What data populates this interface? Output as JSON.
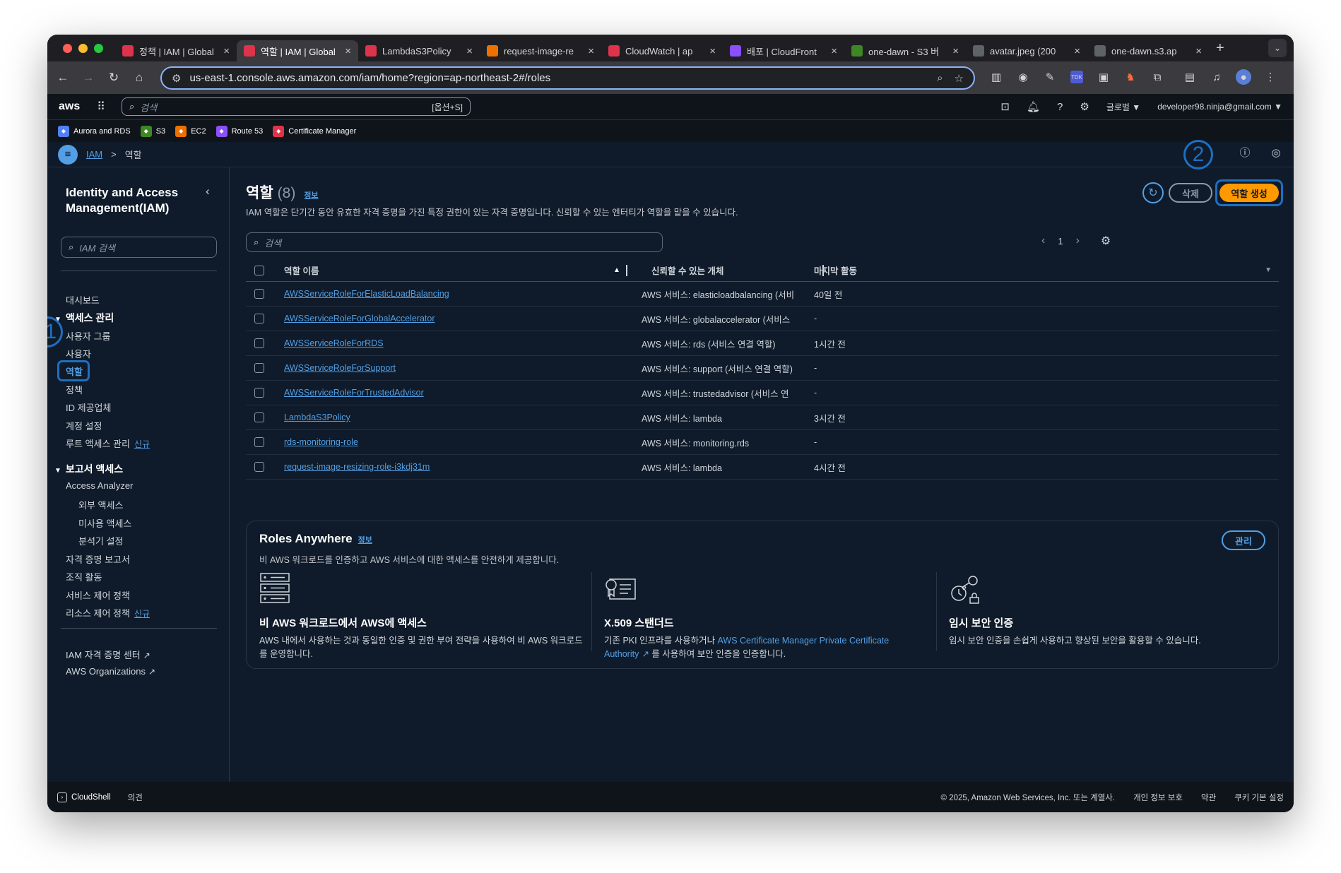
{
  "browser": {
    "tabs": [
      {
        "title": "정책 | IAM | Global",
        "active": false,
        "color": "#dd344c"
      },
      {
        "title": "역할 | IAM | Global",
        "active": true,
        "color": "#dd344c"
      },
      {
        "title": "LambdaS3Policy",
        "active": false,
        "color": "#dd344c"
      },
      {
        "title": "request-image-re",
        "active": false,
        "color": "#ed7100"
      },
      {
        "title": "CloudWatch | ap",
        "active": false,
        "color": "#dd344c"
      },
      {
        "title": "배포 | CloudFront",
        "active": false,
        "color": "#8c4fff"
      },
      {
        "title": "one-dawn - S3 버",
        "active": false,
        "color": "#3f8624"
      },
      {
        "title": "avatar.jpeg (200",
        "active": false,
        "color": "#5f6368"
      },
      {
        "title": "one-dawn.s3.ap",
        "active": false,
        "color": "#5f6368"
      }
    ],
    "url": "us-east-1.console.aws.amazon.com/iam/home?region=ap-northeast-2#/roles"
  },
  "aws_header": {
    "logo": "aws",
    "search_placeholder": "검색",
    "search_shortcut": "[옵션+S]",
    "region": "글로벌 ▼",
    "account": "developer98.ninja@gmail.com ▼"
  },
  "favorites": [
    {
      "label": "Aurora and RDS",
      "color": "#527fff"
    },
    {
      "label": "S3",
      "color": "#3f8624"
    },
    {
      "label": "EC2",
      "color": "#ed7100"
    },
    {
      "label": "Route 53",
      "color": "#8c4fff"
    },
    {
      "label": "Certificate Manager",
      "color": "#dd344c"
    }
  ],
  "breadcrumb": {
    "root": "IAM",
    "sep": ">",
    "current": "역할"
  },
  "annotations": {
    "one": "1",
    "two": "2"
  },
  "sidebar": {
    "title": "Identity and Access Management(IAM)",
    "search_placeholder": "IAM 검색",
    "dashboard": "대시보드",
    "access_mgmt": "액세스 관리",
    "items_access": [
      "사용자 그룹",
      "사용자",
      "역할",
      "정책",
      "ID 제공업체",
      "계정 설정",
      "루트 액세스 관리"
    ],
    "new_badge": "신규",
    "reports": "보고서 액세스",
    "access_analyzer": "Access Analyzer",
    "analyzer_sub": [
      "외부 액세스",
      "미사용 액세스",
      "분석기 설정"
    ],
    "report_items": [
      "자격 증명 보고서",
      "조직 활동",
      "서비스 제어 정책",
      "리소스 제어 정책"
    ],
    "links": [
      "IAM 자격 증명 센터",
      "AWS Organizations"
    ]
  },
  "main": {
    "title": "역할",
    "count": "(8)",
    "info": "정보",
    "description": "IAM 역할은 단기간 동안 유효한 자격 증명을 가진 특정 권한이 있는 자격 증명입니다. 신뢰할 수 있는 엔터티가 역할을 맡을 수 있습니다.",
    "delete_btn": "삭제",
    "create_btn": "역할 생성",
    "search_placeholder": "검색",
    "page": "1",
    "columns": [
      "역할 이름",
      "신뢰할 수 있는 개체",
      "마지막 활동"
    ],
    "rows": [
      {
        "name": "AWSServiceRoleForElasticLoadBalancing",
        "trusted": "AWS 서비스: elasticloadbalancing (서비",
        "last": "40일 전"
      },
      {
        "name": "AWSServiceRoleForGlobalAccelerator",
        "trusted": "AWS 서비스: globalaccelerator (서비스",
        "last": "-"
      },
      {
        "name": "AWSServiceRoleForRDS",
        "trusted": "AWS 서비스: rds (서비스 연결 역할)",
        "last": "1시간 전"
      },
      {
        "name": "AWSServiceRoleForSupport",
        "trusted": "AWS 서비스: support (서비스 연결 역할)",
        "last": "-"
      },
      {
        "name": "AWSServiceRoleForTrustedAdvisor",
        "trusted": "AWS 서비스: trustedadvisor (서비스 연",
        "last": "-"
      },
      {
        "name": "LambdaS3Policy",
        "trusted": "AWS 서비스: lambda",
        "last": "3시간 전"
      },
      {
        "name": "rds-monitoring-role",
        "trusted": "AWS 서비스: monitoring.rds",
        "last": "-"
      },
      {
        "name": "request-image-resizing-role-i3kdj31m",
        "trusted": "AWS 서비스: lambda",
        "last": "4시간 전"
      }
    ]
  },
  "roles_anywhere": {
    "title": "Roles Anywhere",
    "info": "정보",
    "description": "비 AWS 워크로드를 인증하고 AWS 서비스에 대한 액세스를 안전하게 제공합니다.",
    "manage_btn": "관리",
    "cards": [
      {
        "heading": "비 AWS 워크로드에서 AWS에 액세스",
        "text": "AWS 내에서 사용하는 것과 동일한 인증 및 권한 부여 전략을 사용하여 비 AWS 워크로드를 운영합니다."
      },
      {
        "heading": "X.509 스탠더드",
        "text_before": "기존 PKI 인프라를 사용하거나 ",
        "link": "AWS Certificate Manager Private Certificate Authority",
        "text_after": " 를 사용하여 보안 인증을 인증합니다."
      },
      {
        "heading": "임시 보안 인증",
        "text": "임시 보안 인증을 손쉽게 사용하고 향상된 보안을 활용할 수 있습니다."
      }
    ]
  },
  "footer": {
    "cloudshell": "CloudShell",
    "feedback": "의견",
    "copyright": "© 2025, Amazon Web Services, Inc. 또는 계열사.",
    "privacy": "개인 정보 보호",
    "terms": "약관",
    "cookies": "쿠키 기본 설정"
  }
}
